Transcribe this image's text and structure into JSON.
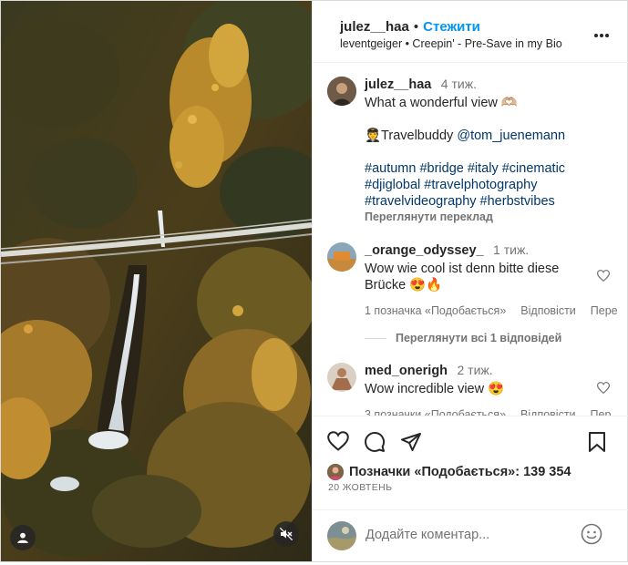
{
  "header": {
    "username": "julez__haa",
    "dot": "•",
    "follow_label": "Стежити",
    "subtitle": "leventgeiger • Creepin' - Pre-Save in my Bio"
  },
  "caption": {
    "username": "julez__haa",
    "time": "4 тиж.",
    "line1": "What a wonderful view 🫶🏼",
    "travelbuddy_prefix": "🧑‍✈️Travelbuddy ",
    "mention": "@tom_juenemann",
    "hashtags_line1": "#autumn #bridge #italy #cinematic",
    "hashtags_line2": "#djiglobal #travelphotography",
    "hashtags_line3": "#travelvideography #herbstvibes",
    "translate_label": "Переглянути переклад"
  },
  "comments": [
    {
      "username": "_orange_odyssey_",
      "time": "1 тиж.",
      "text_line1": "Wow wie cool ist denn bitte diese",
      "text_line2": "Brücke 😍🔥",
      "likes_label": "1 позначка «Подобається»",
      "reply_label": "Відповісти",
      "extra_label": "Пере",
      "view_replies_label": "Переглянути всі 1 відповідей"
    },
    {
      "username": "med_onerigh",
      "time": "2 тиж.",
      "text_line1": "Wow incredible view 😍",
      "likes_label": "3 позначки «Подобається»",
      "reply_label": "Відповісти",
      "extra_label": "Пер"
    }
  ],
  "actions": {
    "likes_prefix": "Позначки «Подобається»: ",
    "likes_count": "139 354",
    "date": "20 ЖОВТЕНЬ"
  },
  "add_comment": {
    "placeholder": "Додайте коментар..."
  },
  "icons": {
    "tag": "user-tag-icon",
    "mute": "speaker-muted-icon",
    "more": "more-horizontal-icon",
    "like": "heart-icon",
    "comment": "comment-icon",
    "share": "paper-plane-icon",
    "save": "bookmark-icon",
    "emoji": "smiley-icon"
  },
  "colors": {
    "follow": "#0095f6",
    "link": "#00376b",
    "muted_text": "#737373",
    "border": "#efefef"
  }
}
